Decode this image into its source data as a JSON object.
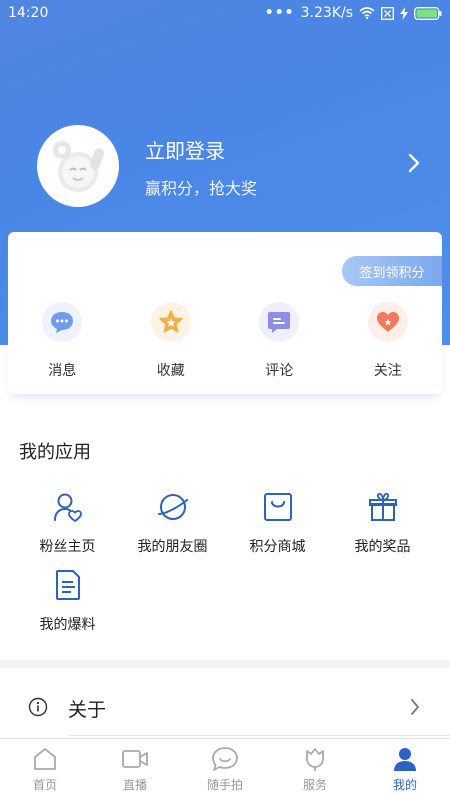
{
  "status_bar": {
    "time": "14:20",
    "dots": "•••",
    "speed": "3.23K/s"
  },
  "profile": {
    "title": "立即登录",
    "subtitle": "赢积分，抢大奖"
  },
  "checkin": {
    "label": "签到领积分"
  },
  "quick_actions": [
    {
      "label": "消息",
      "icon": "message-icon"
    },
    {
      "label": "收藏",
      "icon": "star-icon"
    },
    {
      "label": "评论",
      "icon": "comment-icon"
    },
    {
      "label": "关注",
      "icon": "heart-icon"
    }
  ],
  "apps": {
    "title": "我的应用",
    "items": [
      {
        "label": "粉丝主页",
        "icon": "fan-user-icon"
      },
      {
        "label": "我的朋友圈",
        "icon": "planet-icon"
      },
      {
        "label": "积分商城",
        "icon": "shop-bag-icon"
      },
      {
        "label": "我的奖品",
        "icon": "gift-icon"
      },
      {
        "label": "我的爆料",
        "icon": "document-icon"
      }
    ]
  },
  "about": {
    "label": "关于"
  },
  "bottom_nav": [
    {
      "label": "首页",
      "icon": "home-icon",
      "active": false
    },
    {
      "label": "直播",
      "icon": "video-icon",
      "active": false
    },
    {
      "label": "随手拍",
      "icon": "camera-chat-icon",
      "active": false
    },
    {
      "label": "服务",
      "icon": "tulip-icon",
      "active": false
    },
    {
      "label": "我的",
      "icon": "person-icon",
      "active": true
    }
  ],
  "colors": {
    "header_blue": "#4a86e6",
    "active_blue": "#2d62c4",
    "inactive_gray": "#999999"
  }
}
